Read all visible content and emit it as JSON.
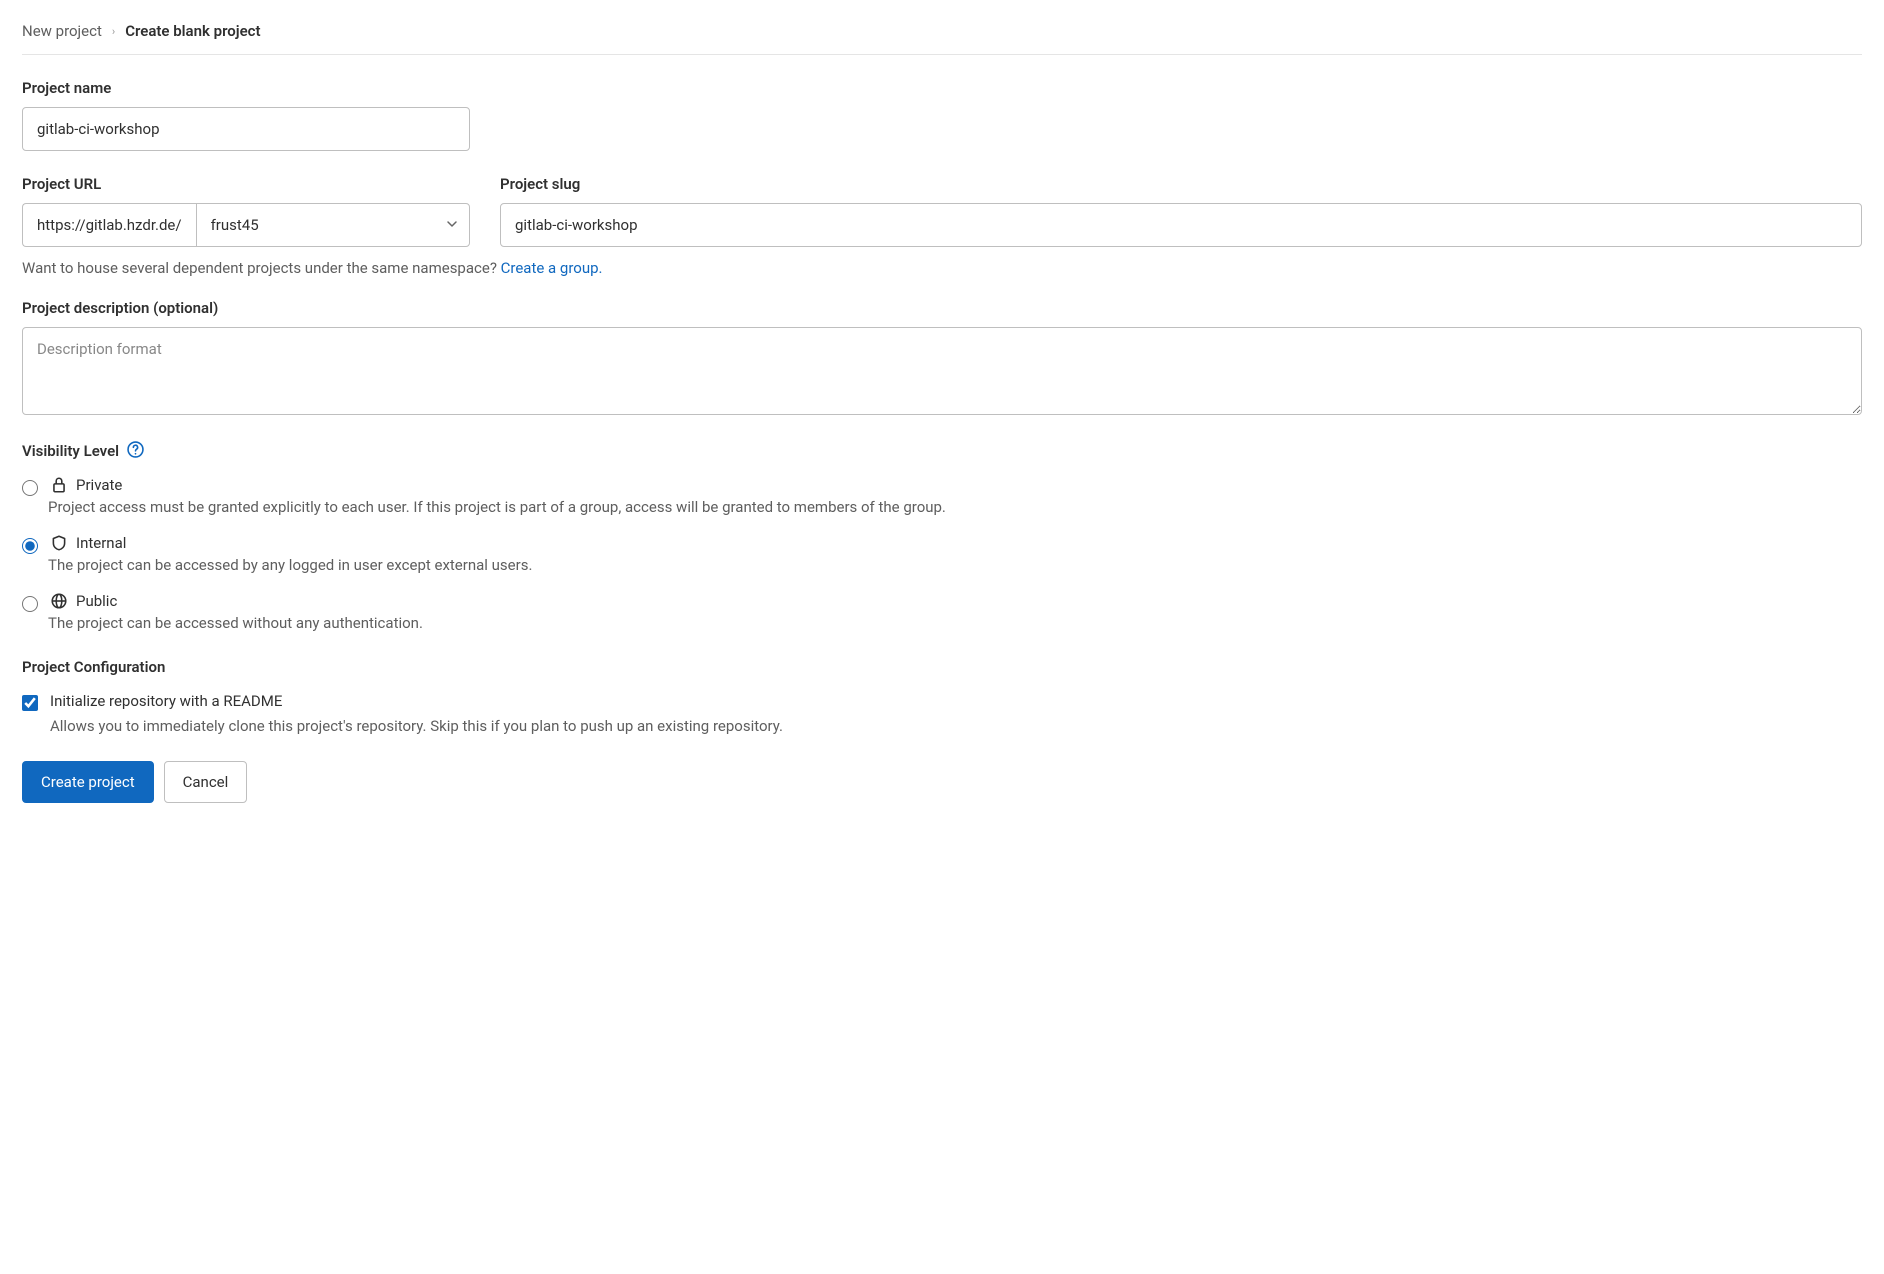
{
  "breadcrumb": {
    "parent": "New project",
    "current": "Create blank project"
  },
  "labels": {
    "project_name": "Project name",
    "project_url": "Project URL",
    "project_slug": "Project slug",
    "project_description": "Project description (optional)",
    "visibility_level": "Visibility Level",
    "project_configuration": "Project Configuration"
  },
  "fields": {
    "project_name_value": "gitlab-ci-workshop",
    "url_prefix": "https://gitlab.hzdr.de/",
    "namespace_selected": "frust45",
    "project_slug_value": "gitlab-ci-workshop",
    "description_value": "",
    "description_placeholder": "Description format"
  },
  "hints": {
    "namespace_text": "Want to house several dependent projects under the same namespace? ",
    "namespace_link": "Create a group."
  },
  "visibility": {
    "options": [
      {
        "label": "Private",
        "desc": "Project access must be granted explicitly to each user. If this project is part of a group, access will be granted to members of the group."
      },
      {
        "label": "Internal",
        "desc": "The project can be accessed by any logged in user except external users."
      },
      {
        "label": "Public",
        "desc": "The project can be accessed without any authentication."
      }
    ]
  },
  "configuration": {
    "readme_label": "Initialize repository with a README",
    "readme_desc": "Allows you to immediately clone this project's repository. Skip this if you plan to push up an existing repository."
  },
  "buttons": {
    "submit": "Create project",
    "cancel": "Cancel"
  }
}
